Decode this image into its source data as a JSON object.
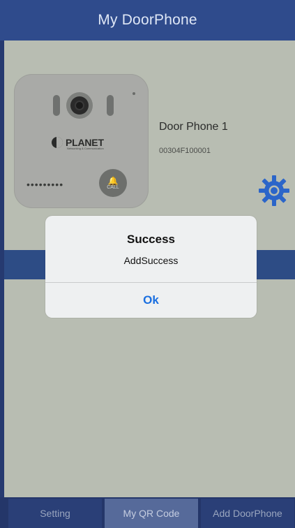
{
  "app": {
    "title": "My DoorPhone"
  },
  "device": {
    "name": "Door Phone 1",
    "id": "00304F100001",
    "brand": "PLANET",
    "brand_sub": "Networking & Communication",
    "dots": "•••••••••",
    "call_label": "CALL"
  },
  "tabs": [
    {
      "label": "Setting"
    },
    {
      "label": "My QR Code"
    },
    {
      "label": "Add DoorPhone"
    }
  ],
  "dialog": {
    "title": "Success",
    "message": "AddSuccess",
    "button": "Ok"
  },
  "colors": {
    "header": "#2f4b8c",
    "accent_button": "#1a6fe0",
    "gear": "#2b65c9"
  },
  "icons": {
    "settings": "gear-icon",
    "call": "bell-icon",
    "brand": "planet-logo-icon"
  }
}
